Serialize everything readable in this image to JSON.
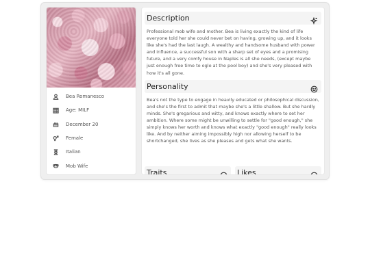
{
  "profile": {
    "attributes": [
      {
        "icon": "user-icon",
        "text": "Bea Romanesco"
      },
      {
        "icon": "calendar-grid-icon",
        "text": "Age: MILF"
      },
      {
        "icon": "cake-icon",
        "text": "December 20"
      },
      {
        "icon": "gender-icon",
        "text": "Female"
      },
      {
        "icon": "hourglass-icon",
        "text": "Italian"
      },
      {
        "icon": "mask-icon",
        "text": "Mob Wife"
      }
    ]
  },
  "sections": {
    "description": {
      "title": "Description",
      "icon": "sparkles-icon",
      "body": "Professional mob wife and mother. Bea is living exactly the kind of life everyone told her she could never bet on having, growing up, and it looks like she's had the last laugh. A wealthy and handsome husband with power and influence, a successful son with a sharp set of eyes and a promising future, and a very comfy house in Naples is all she needs, (except maybe just enough free time to ogle at the pool boy) and she's very pleased with how it's all gone."
    },
    "personality": {
      "title": "Personality",
      "icon": "smiley-icon",
      "body": "Bea's not the type to engage in heavily educated or philosophical discussion, and she's the first to admit that maybe she's a little shallow. But she hardly minds. She's gregarious and witty, and knows exactly where to set her ambition. Where some might be unwilling to settle for \"good enough,\" she simply knows her worth and knows what exactly \"good enough\" really looks like. And by neither aiming impossibly high nor allowing herself to be shortchanged, she lives as she pleases and gets what she wants."
    },
    "traits": {
      "title": "Traits",
      "icon": "face-icon"
    },
    "likes": {
      "title": "Likes",
      "icon": "heart-icon"
    }
  }
}
